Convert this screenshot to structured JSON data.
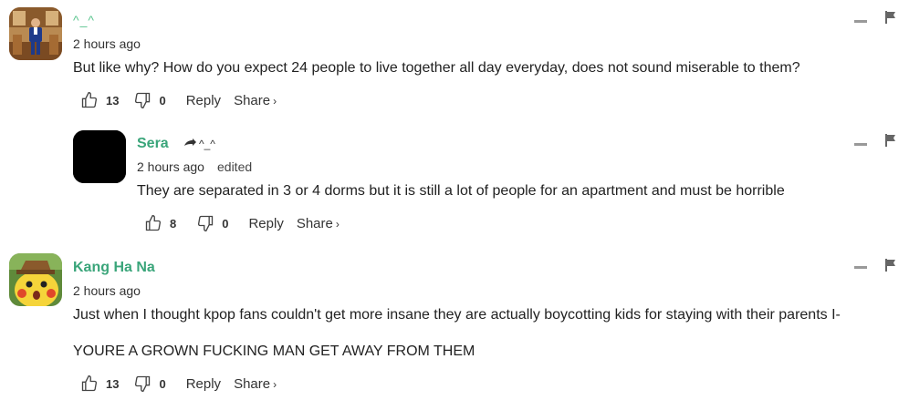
{
  "comments": [
    {
      "username": "^_^",
      "timestamp": "2 hours ago",
      "text": "But like why? How do you expect 24 people to live together all day everyday, does not sound miserable to them?",
      "likes": "13",
      "dislikes": "0",
      "reply_label": "Reply",
      "share_label": "Share",
      "avatar_icon": "person-avatar"
    },
    {
      "username": "Sera",
      "reply_to": "^_^",
      "timestamp": "2 hours ago",
      "edited_label": "edited",
      "text": "They are separated in 3 or 4 dorms but it is still a lot of people for an apartment and must be horrible",
      "likes": "8",
      "dislikes": "0",
      "reply_label": "Reply",
      "share_label": "Share",
      "avatar_icon": "black-avatar"
    },
    {
      "username": "Kang Ha Na",
      "timestamp": "2 hours ago",
      "text_lines": [
        "Just when I thought kpop fans couldn't get more insane they are actually boycotting kids for staying with their parents I-",
        "YOURE A GROWN FUCKING MAN GET AWAY FROM THEM"
      ],
      "likes": "13",
      "dislikes": "0",
      "reply_label": "Reply",
      "share_label": "Share",
      "avatar_icon": "pikachu-avatar"
    }
  ],
  "colors": {
    "username": "#3aa57a",
    "text": "#222222",
    "muted": "#999999"
  },
  "icons": {
    "like": "thumbs-up-icon",
    "dislike": "thumbs-down-icon",
    "minimize": "minimize-icon",
    "flag": "flag-icon",
    "reply_arrow": "reply-arrow-icon",
    "share_chevron": "chevron-right-icon"
  },
  "share_chevron": "›"
}
